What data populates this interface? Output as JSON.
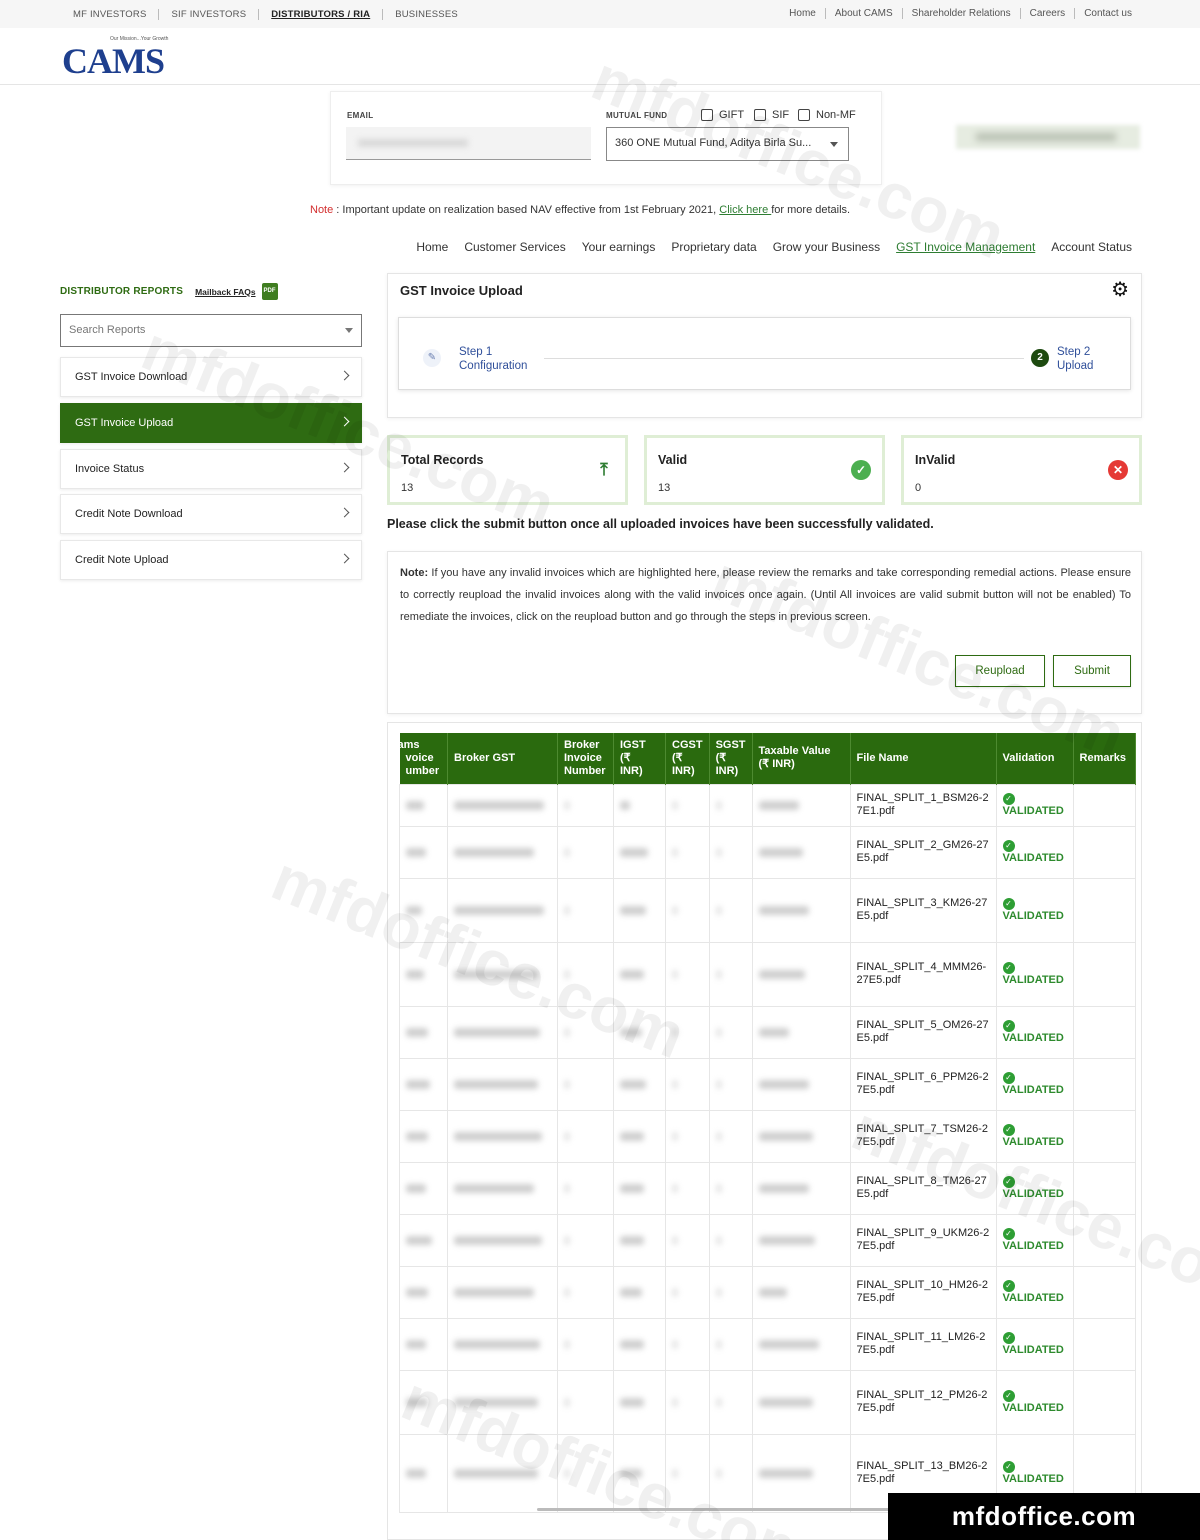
{
  "topbar": {
    "left": [
      "MF INVESTORS",
      "SIF INVESTORS",
      "DISTRIBUTORS / RIA",
      "BUSINESSES"
    ],
    "right": [
      "Home",
      "About CAMS",
      "Shareholder Relations",
      "Careers",
      "Contact us"
    ]
  },
  "logo": {
    "text": "CAMS",
    "tagline": "Our Mission...Your Growth"
  },
  "filters": {
    "email_label": "EMAIL",
    "mf_label": "MUTUAL FUND",
    "checkboxes": [
      "GIFT",
      "SIF",
      "Non-MF"
    ],
    "mf_selected": "360 ONE Mutual Fund, Aditya Birla Su..."
  },
  "notice": {
    "prefix": "Note",
    "text": " : Important update on realization based NAV effective from 1st February 2021, ",
    "link": "Click here ",
    "suffix": "for more details."
  },
  "nav": [
    "Home",
    "Customer Services",
    "Your earnings",
    "Proprietary data",
    "Grow your Business",
    "GST Invoice Management",
    "Account Status"
  ],
  "sidebar": {
    "title": "DISTRIBUTOR REPORTS",
    "faq": "Mailback FAQs",
    "pdf": "PDF",
    "search_placeholder": "Search Reports",
    "items": [
      "GST Invoice Download",
      "GST Invoice Upload",
      "Invoice Status",
      "Credit Note Download",
      "Credit Note Upload"
    ]
  },
  "upload": {
    "title": "GST Invoice Upload",
    "step1_line1": "Step 1",
    "step1_line2": "Configuration",
    "step2_num": "2",
    "step2_line1": "Step 2",
    "step2_line2": "Upload"
  },
  "summary": [
    {
      "label": "Total Records",
      "value": "13",
      "icon": "upload-icon",
      "color": "#2e7d32"
    },
    {
      "label": "Valid",
      "value": "13",
      "icon": "check-circle-icon",
      "color": "#4caf50"
    },
    {
      "label": "InValid",
      "value": "0",
      "icon": "x-circle-icon",
      "color": "#e53935"
    }
  ],
  "submit_message": "Please click the submit button once all uploaded invoices have been successfully validated.",
  "note": {
    "label": "Note:",
    "text": " If you have any invalid invoices which are highlighted here, please review the remarks and take corresponding remedial actions. Please ensure to correctly reupload the invalid invoices along with the valid invoices once again. (Until All invoices are valid submit button will not be enabled) To remediate the invoices, click on the reupload button and go through the steps in previous screen.",
    "reupload": "Reupload",
    "submit": "Submit"
  },
  "table": {
    "headers": [
      "ams\nvoice\number",
      "Broker GST",
      "Broker\nInvoice\nNumber",
      "IGST (₹\nINR)",
      "CGST\n(₹\nINR)",
      "SGST\n(₹\nINR)",
      "Taxable Value\n(₹ INR)",
      "File Name",
      "Validation",
      "Remarks"
    ],
    "rows": [
      {
        "file": "FINAL_SPLIT_1_BSM26-27E1.pdf",
        "status": "VALIDATED"
      },
      {
        "file": "FINAL_SPLIT_2_GM26-27E5.pdf",
        "status": "VALIDATED"
      },
      {
        "file": "FINAL_SPLIT_3_KM26-27E5.pdf",
        "status": "VALIDATED"
      },
      {
        "file": "FINAL_SPLIT_4_MMM26-27E5.pdf",
        "status": "VALIDATED"
      },
      {
        "file": "FINAL_SPLIT_5_OM26-27E5.pdf",
        "status": "VALIDATED"
      },
      {
        "file": "FINAL_SPLIT_6_PPM26-27E5.pdf",
        "status": "VALIDATED"
      },
      {
        "file": "FINAL_SPLIT_7_TSM26-27E5.pdf",
        "status": "VALIDATED"
      },
      {
        "file": "FINAL_SPLIT_8_TM26-27E5.pdf",
        "status": "VALIDATED"
      },
      {
        "file": "FINAL_SPLIT_9_UKM26-27E5.pdf",
        "status": "VALIDATED"
      },
      {
        "file": "FINAL_SPLIT_10_HM26-27E5.pdf",
        "status": "VALIDATED"
      },
      {
        "file": "FINAL_SPLIT_11_LM26-27E5.pdf",
        "status": "VALIDATED"
      },
      {
        "file": "FINAL_SPLIT_12_PM26-27E5.pdf",
        "status": "VALIDATED"
      },
      {
        "file": "FINAL_SPLIT_13_BM26-27E5.pdf",
        "status": "VALIDATED"
      }
    ]
  },
  "watermark": "mfdoffice.com",
  "brand": "mfdoffice.com"
}
